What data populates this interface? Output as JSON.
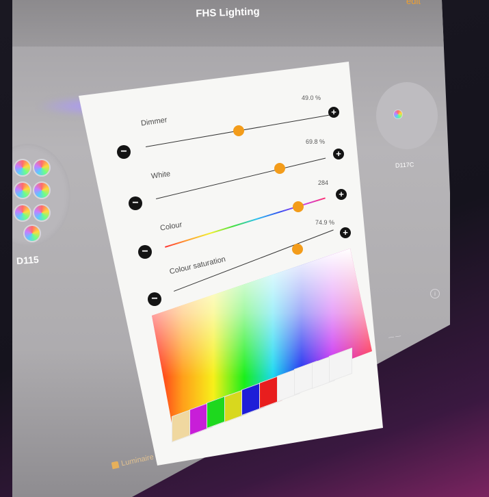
{
  "app": {
    "title": "FHS Lighting",
    "edit_label": "edit"
  },
  "luminaires": [
    {
      "label": "D115"
    },
    {
      "label": "D117C"
    }
  ],
  "bottom_nav": {
    "luminaires_label": "Luminaire"
  },
  "controls": {
    "dimmer": {
      "label": "Dimmer",
      "value": "49.0 %",
      "level": 0.49
    },
    "white": {
      "label": "White",
      "value": "69.8 %",
      "level": 0.698
    },
    "colour": {
      "label": "Colour",
      "value": "284",
      "level": 0.79
    },
    "saturation": {
      "label": "Colour saturation",
      "value": "74.9 %",
      "level": 0.749
    }
  },
  "buttons": {
    "minus": "−",
    "plus": "+"
  },
  "swatch_colors": [
    "#f0d8a0",
    "#c81ed8",
    "#1ed81e",
    "#d8d81e",
    "#1e1ed8",
    "#e81e1e",
    "#ffffff",
    "#ffffff",
    "#ffffff",
    "#ffffff"
  ],
  "accent_color": "#f39c1a"
}
